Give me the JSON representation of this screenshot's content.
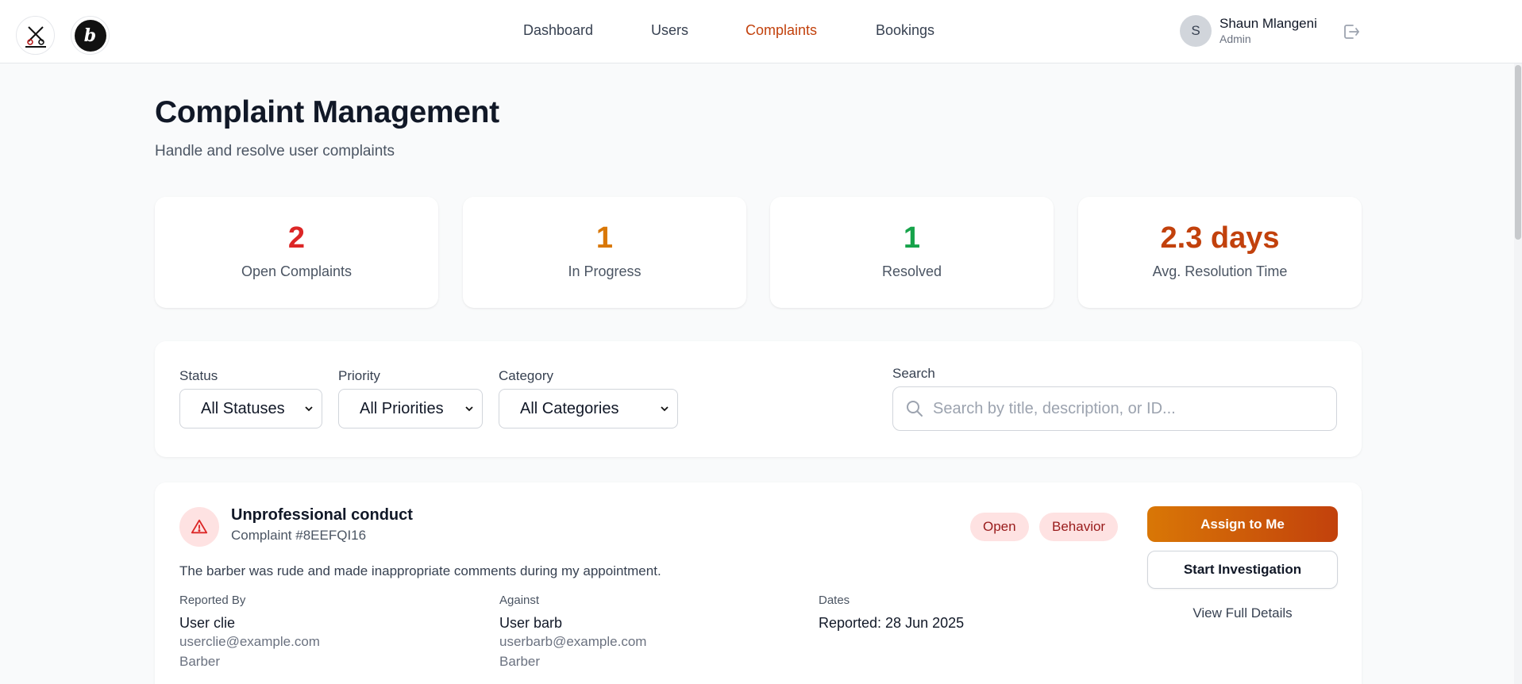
{
  "header": {
    "logos": [
      "BarberConnect",
      "b"
    ],
    "nav": [
      {
        "label": "Dashboard",
        "active": false
      },
      {
        "label": "Users",
        "active": false
      },
      {
        "label": "Complaints",
        "active": true
      },
      {
        "label": "Bookings",
        "active": false
      }
    ],
    "user": {
      "initial": "S",
      "name": "Shaun Mlangeni",
      "role": "Admin"
    },
    "logout_icon": "logout-icon"
  },
  "page": {
    "title": "Complaint Management",
    "subtitle": "Handle and resolve user complaints"
  },
  "stats": [
    {
      "value": "2",
      "label": "Open Complaints",
      "color": "#dc2626"
    },
    {
      "value": "1",
      "label": "In Progress",
      "color": "#d97706"
    },
    {
      "value": "1",
      "label": "Resolved",
      "color": "#16a34a"
    },
    {
      "value": "2.3 days",
      "label": "Avg. Resolution Time",
      "color": "#c2410c"
    }
  ],
  "filters": {
    "status": {
      "label": "Status",
      "value": "All Statuses"
    },
    "priority": {
      "label": "Priority",
      "value": "All Priorities"
    },
    "category": {
      "label": "Category",
      "value": "All Categories"
    },
    "search": {
      "label": "Search",
      "placeholder": "Search by title, description, or ID...",
      "value": ""
    }
  },
  "complaint": {
    "icon": "warning-triangle-icon",
    "title": "Unprofessional conduct",
    "id": "Complaint #8EEFQI16",
    "badges": [
      "Open",
      "Behavior"
    ],
    "description": "The barber was rude and made inappropriate comments during my appointment.",
    "reported_by": {
      "heading": "Reported By",
      "name": "User clie",
      "email": "userclie@example.com",
      "role": "Barber"
    },
    "against": {
      "heading": "Against",
      "name": "User barb",
      "email": "userbarb@example.com",
      "role": "Barber"
    },
    "dates": {
      "heading": "Dates",
      "reported": "Reported: 28 Jun 2025"
    },
    "actions": {
      "assign": "Assign to Me",
      "investigate": "Start Investigation",
      "details": "View Full Details"
    }
  }
}
